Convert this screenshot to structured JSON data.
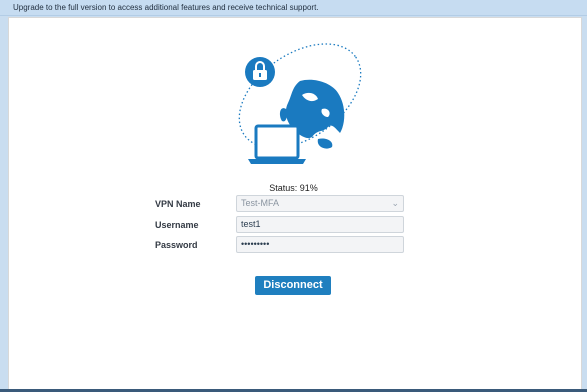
{
  "banner": {
    "text": "Upgrade to the full version to access additional features and receive technical support."
  },
  "illustration": {
    "icons": [
      "lock-icon",
      "globe-icon",
      "laptop-icon"
    ],
    "colors": {
      "primary": "#1a7ac0",
      "orbit": "#1a7ac0"
    }
  },
  "status": {
    "text": "Status: 91%"
  },
  "form": {
    "vpn_name": {
      "label": "VPN Name",
      "value": "Test-MFA"
    },
    "username": {
      "label": "Username",
      "value": "test1"
    },
    "password": {
      "label": "Password",
      "value": "•••••••••"
    }
  },
  "actions": {
    "disconnect_label": "Disconnect"
  }
}
